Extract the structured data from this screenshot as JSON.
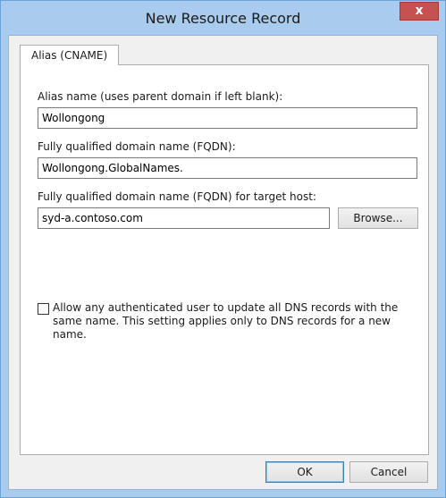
{
  "window": {
    "title": "New Resource Record",
    "close_glyph": "x"
  },
  "tabs": [
    {
      "label": "Alias (CNAME)",
      "selected": true
    }
  ],
  "form": {
    "alias_label": "Alias name (uses parent domain if left blank):",
    "alias_value": "Wollongong",
    "fqdn_label": "Fully qualified domain name (FQDN):",
    "fqdn_value": "Wollongong.GlobalNames.",
    "target_label": "Fully qualified domain name (FQDN) for target host:",
    "target_value": "syd-a.contoso.com",
    "browse_label": "Browse...",
    "update_checkbox_label": "Allow any authenticated user to update all DNS records with the same name. This setting applies only to DNS records for a new name.",
    "update_checkbox_checked": false
  },
  "footer": {
    "ok_label": "OK",
    "cancel_label": "Cancel"
  },
  "colors": {
    "title_bar": "#a9cbee",
    "close_button": "#c75050",
    "client_bg": "#f0f0f0"
  }
}
